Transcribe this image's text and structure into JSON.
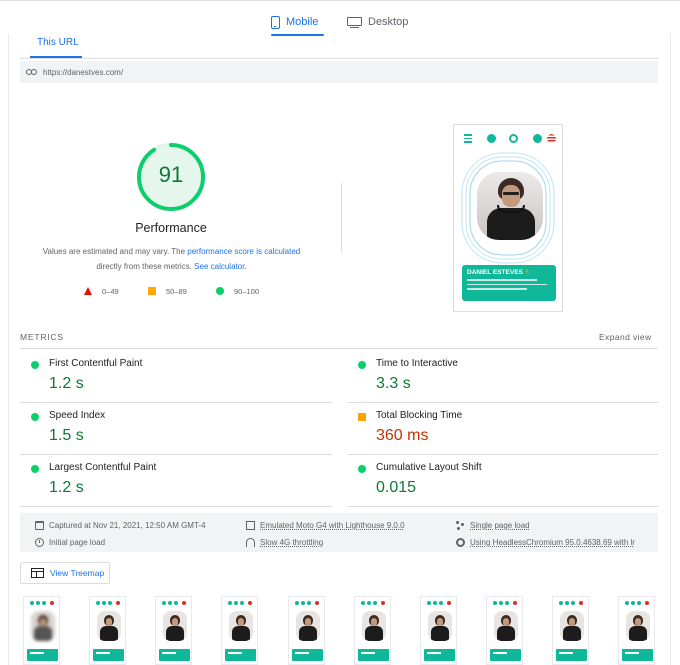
{
  "device_tabs": [
    {
      "label": "Mobile",
      "icon": "mobile-phone-icon",
      "selected": true
    },
    {
      "label": "Desktop",
      "icon": "desktop-monitor-icon",
      "selected": false
    }
  ],
  "url_tab": {
    "label": "This URL"
  },
  "url_bar": {
    "icon": "link-icon",
    "url": "https://danestves.com/"
  },
  "performance": {
    "score": "91",
    "title": "Performance",
    "desc_prefix": "Values are estimated and may vary. The ",
    "desc_link1": "performance score is calculated",
    "desc_middle": " directly from these metrics. ",
    "desc_link2": "See calculator.",
    "score_fraction": 0.91,
    "colors": {
      "pass": "#0cce6b",
      "average": "#ffa400",
      "fail": "#eb0f00",
      "pass_text": "#0c7a35",
      "average_text": "#c33300"
    }
  },
  "legend": [
    {
      "icon": "fail-triangle-icon",
      "label": "0–49"
    },
    {
      "icon": "average-square-icon",
      "label": "50–89"
    },
    {
      "icon": "pass-circle-icon",
      "label": "90–100"
    }
  ],
  "screenshot": {
    "card_name_first": "DANIEL ESTEVES ",
    "card_name_emoji": "✌"
  },
  "metrics": {
    "heading": "METRICS",
    "expand_label": "Expand view",
    "items": [
      {
        "name": "First Contentful Paint",
        "value": "1.2 s",
        "rating": "pass"
      },
      {
        "name": "Time to Interactive",
        "value": "3.3 s",
        "rating": "pass"
      },
      {
        "name": "Speed Index",
        "value": "1.5 s",
        "rating": "pass"
      },
      {
        "name": "Total Blocking Time",
        "value": "360 ms",
        "rating": "average"
      },
      {
        "name": "Largest Contentful Paint",
        "value": "1.2 s",
        "rating": "pass"
      },
      {
        "name": "Cumulative Layout Shift",
        "value": "0.015",
        "rating": "pass"
      }
    ]
  },
  "run_info": {
    "captured": "Captured at Nov 21, 2021, 12:50 AM GMT-4",
    "initial_load": "Initial page load",
    "device": "Emulated Moto G4 with Lighthouse 9.0.0",
    "throttling": "Slow 4G throttling",
    "single_load": "Single page load",
    "browser": "Using HeadlessChromium 95.0.4638.69 with lr"
  },
  "treemap": {
    "label": "View Treemap",
    "icon": "treemap-icon"
  }
}
